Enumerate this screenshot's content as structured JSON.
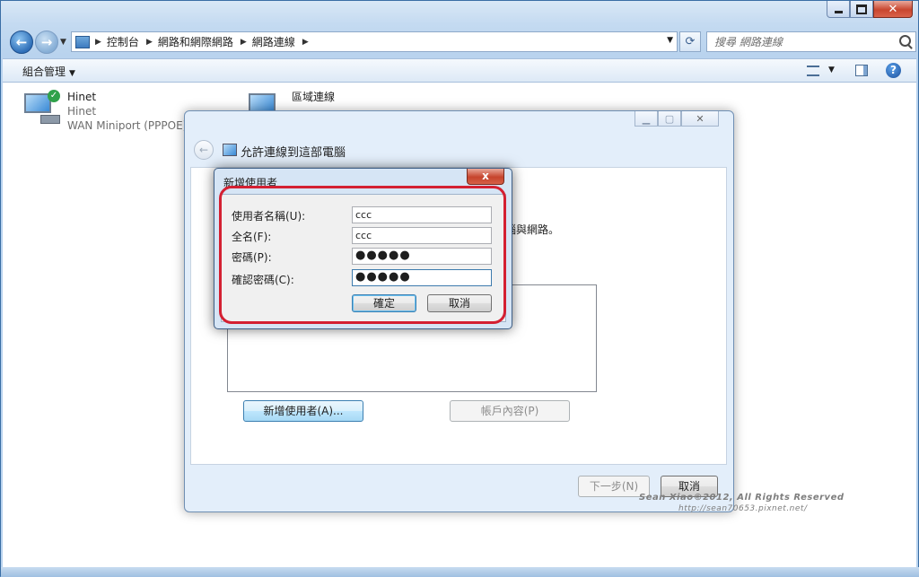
{
  "explorer": {
    "breadcrumb": [
      "控制台",
      "網路和網際網路",
      "網路連線"
    ],
    "search_placeholder": "搜尋 網路連線",
    "organize_label": "組合管理",
    "connections": [
      {
        "name": "Hinet",
        "line2": "Hinet",
        "line3": "WAN Miniport (PPPOE)"
      },
      {
        "name": "區域連線",
        "line2": "",
        "line3": ""
      }
    ]
  },
  "wizard": {
    "title": "允許連線到這部電腦",
    "desc_fragment": "腦與網路。",
    "add_user_label": "新增使用者(A)...",
    "account_props_label": "帳戶內容(P)",
    "next_label": "下一步(N)",
    "cancel_label": "取消"
  },
  "new_user_dialog": {
    "title": "新增使用者",
    "close_glyph": "x",
    "fields": [
      {
        "label": "使用者名稱(U):",
        "value": "ccc"
      },
      {
        "label": "全名(F):",
        "value": "ccc"
      },
      {
        "label": "密碼(P):",
        "value": "●●●●●"
      },
      {
        "label": "確認密碼(C):",
        "value": "●●●●●"
      }
    ],
    "ok_label": "確定",
    "cancel_label": "取消"
  },
  "watermark": {
    "line1": "Sean Xiao©2012, All Rights Reserved",
    "line2": "http://sean70653.pixnet.net/"
  },
  "colors": {
    "highlight": "#d42032",
    "window_frame": "#b9d3ee",
    "close_button": "#c8462f"
  },
  "icons": [
    "back-arrow-icon",
    "forward-arrow-icon",
    "refresh-icon",
    "search-icon",
    "view-icon",
    "preview-pane-icon",
    "help-icon",
    "network-connection-icon",
    "check-badge-icon",
    "network-globe-icon"
  ]
}
